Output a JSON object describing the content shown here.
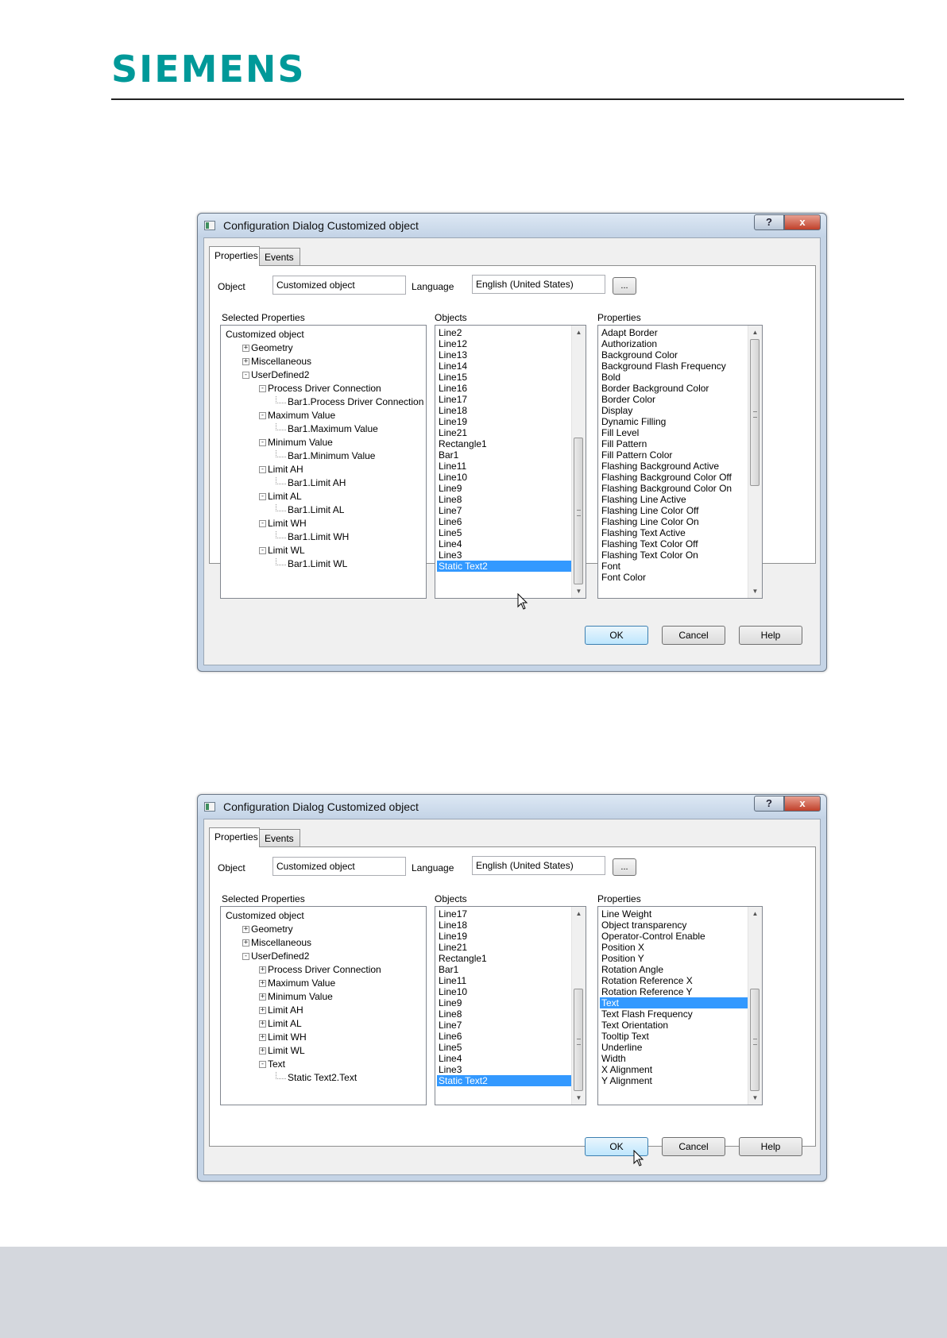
{
  "doc": {
    "logo_text": "SIEMENS"
  },
  "dialogs": [
    {
      "title": "Configuration Dialog Customized object",
      "help_label": "?",
      "close_label": "x",
      "tabs": [
        {
          "label": "Properties"
        },
        {
          "label": "Events"
        }
      ],
      "object_label": "Object",
      "object_value": "Customized object",
      "language_label": "Language",
      "language_value": "English (United States)",
      "dots_label": "...",
      "col_selected": "Selected Properties",
      "col_objects": "Objects",
      "col_properties": "Properties",
      "tree": [
        {
          "depth": 0,
          "toggle": "",
          "label": "Customized object"
        },
        {
          "depth": 1,
          "toggle": "+",
          "label": "Geometry"
        },
        {
          "depth": 1,
          "toggle": "+",
          "label": "Miscellaneous"
        },
        {
          "depth": 1,
          "toggle": "-",
          "label": "UserDefined2"
        },
        {
          "depth": 2,
          "toggle": "-",
          "label": "Process Driver Connection"
        },
        {
          "depth": 3,
          "toggle": "",
          "label": "Bar1.Process Driver Connection"
        },
        {
          "depth": 2,
          "toggle": "-",
          "label": "Maximum Value"
        },
        {
          "depth": 3,
          "toggle": "",
          "label": "Bar1.Maximum Value"
        },
        {
          "depth": 2,
          "toggle": "-",
          "label": "Minimum Value"
        },
        {
          "depth": 3,
          "toggle": "",
          "label": "Bar1.Minimum Value"
        },
        {
          "depth": 2,
          "toggle": "-",
          "label": "Limit AH"
        },
        {
          "depth": 3,
          "toggle": "",
          "label": "Bar1.Limit AH"
        },
        {
          "depth": 2,
          "toggle": "-",
          "label": "Limit AL"
        },
        {
          "depth": 3,
          "toggle": "",
          "label": "Bar1.Limit AL"
        },
        {
          "depth": 2,
          "toggle": "-",
          "label": "Limit WH"
        },
        {
          "depth": 3,
          "toggle": "",
          "label": "Bar1.Limit WH"
        },
        {
          "depth": 2,
          "toggle": "-",
          "label": "Limit WL"
        },
        {
          "depth": 3,
          "toggle": "",
          "label": "Bar1.Limit WL"
        }
      ],
      "objects": [
        "Line2",
        "Line12",
        "Line13",
        "Line14",
        "Line15",
        "Line16",
        "Line17",
        "Line18",
        "Line19",
        "Line21",
        "Rectangle1",
        "Bar1",
        "Line11",
        "Line10",
        "Line9",
        "Line8",
        "Line7",
        "Line6",
        "Line5",
        "Line4",
        "Line3",
        "Static Text2"
      ],
      "objects_selected": "Static Text2",
      "objects_scroll_fraction": 1.0,
      "properties": [
        "Adapt Border",
        "Authorization",
        "Background Color",
        "Background Flash Frequency",
        "Bold",
        "Border Background Color",
        "Border Color",
        "Display",
        "Dynamic Filling",
        "Fill Level",
        "Fill Pattern",
        "Fill Pattern Color",
        "Flashing Background Active",
        "Flashing Background Color Off",
        "Flashing Background Color On",
        "Flashing Line Active",
        "Flashing Line Color Off",
        "Flashing Line Color On",
        "Flashing Text Active",
        "Flashing Text Color Off",
        "Flashing Text Color On",
        "Font",
        "Font Color"
      ],
      "properties_selected": "",
      "properties_scroll_fraction": 0.0,
      "ok_label": "OK",
      "cancel_label": "Cancel",
      "help_button_label": "Help"
    },
    {
      "title": "Configuration Dialog Customized object",
      "help_label": "?",
      "close_label": "x",
      "tabs": [
        {
          "label": "Properties"
        },
        {
          "label": "Events"
        }
      ],
      "object_label": "Object",
      "object_value": "Customized object",
      "language_label": "Language",
      "language_value": "English (United States)",
      "dots_label": "...",
      "col_selected": "Selected Properties",
      "col_objects": "Objects",
      "col_properties": "Properties",
      "tree": [
        {
          "depth": 0,
          "toggle": "",
          "label": "Customized object"
        },
        {
          "depth": 1,
          "toggle": "+",
          "label": "Geometry"
        },
        {
          "depth": 1,
          "toggle": "+",
          "label": "Miscellaneous"
        },
        {
          "depth": 1,
          "toggle": "-",
          "label": "UserDefined2"
        },
        {
          "depth": 2,
          "toggle": "+",
          "label": "Process Driver Connection"
        },
        {
          "depth": 2,
          "toggle": "+",
          "label": "Maximum Value"
        },
        {
          "depth": 2,
          "toggle": "+",
          "label": "Minimum Value"
        },
        {
          "depth": 2,
          "toggle": "+",
          "label": "Limit AH"
        },
        {
          "depth": 2,
          "toggle": "+",
          "label": "Limit AL"
        },
        {
          "depth": 2,
          "toggle": "+",
          "label": "Limit WH"
        },
        {
          "depth": 2,
          "toggle": "+",
          "label": "Limit WL"
        },
        {
          "depth": 2,
          "toggle": "-",
          "label": "Text"
        },
        {
          "depth": 3,
          "toggle": "",
          "label": "Static Text2.Text"
        }
      ],
      "objects": [
        "Line17",
        "Line18",
        "Line19",
        "Line21",
        "Rectangle1",
        "Bar1",
        "Line11",
        "Line10",
        "Line9",
        "Line8",
        "Line7",
        "Line6",
        "Line5",
        "Line4",
        "Line3",
        "Static Text2"
      ],
      "objects_selected": "Static Text2",
      "objects_scroll_fraction": 1.0,
      "properties": [
        "Line Weight",
        "Object transparency",
        "Operator-Control Enable",
        "Position X",
        "Position Y",
        "Rotation Angle",
        "Rotation Reference X",
        "Rotation Reference Y",
        "Text",
        "Text Flash Frequency",
        "Text Orientation",
        "Tooltip Text",
        "Underline",
        "Width",
        "X Alignment",
        "Y Alignment"
      ],
      "properties_selected": "Text",
      "properties_scroll_fraction": 1.0,
      "ok_label": "OK",
      "cancel_label": "Cancel",
      "help_button_label": "Help"
    }
  ]
}
